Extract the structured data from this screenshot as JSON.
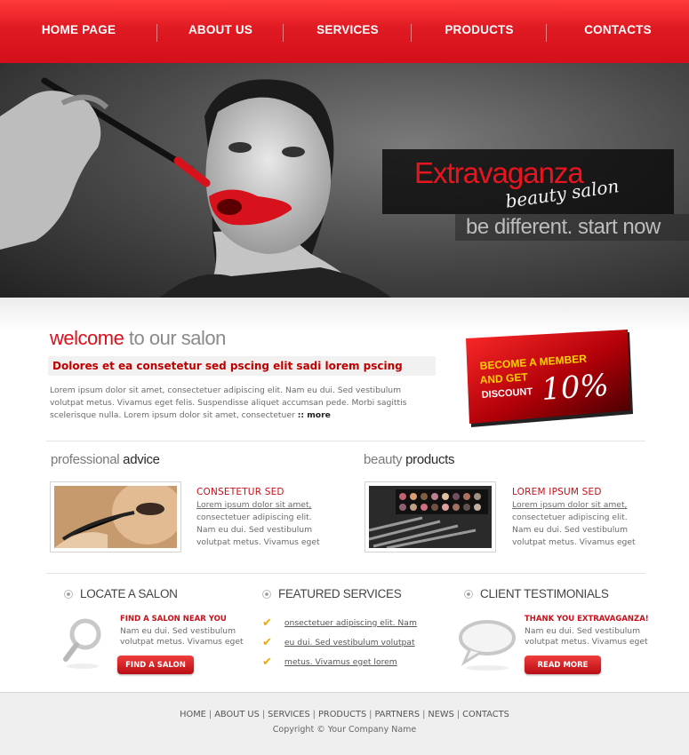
{
  "nav": {
    "items": [
      {
        "label": "HOME PAGE"
      },
      {
        "label": "ABOUT US"
      },
      {
        "label": "SERVICES"
      },
      {
        "label": "PRODUCTS"
      },
      {
        "label": "CONTACTS"
      }
    ]
  },
  "hero": {
    "brand": "Extravaganza",
    "brand_sub": "beauty salon",
    "slogan": "be different. start now"
  },
  "welcome": {
    "title_accent": "welcome",
    "title_rest": " to our salon",
    "subtitle": "Dolores et ea consetetur sed pscing elit sadi lorem pscing",
    "text": "Lorem ipsum dolor sit amet, consectetuer adipiscing elit. Nam eu dui. Sed vestibulum volutpat metus. Vivamus eget felis. Suspendisse aliquet accumsan pede. Morbi sagittis scelerisque nulla. Lorem ipsum dolor sit amet, consectetuer ",
    "more": ":: more"
  },
  "promo": {
    "line1": "BECOME A MEMBER",
    "line2": "AND GET",
    "line3": "DISCOUNT",
    "percent": "10%"
  },
  "advice": {
    "title_light": "professional ",
    "title_bold": "advice",
    "heading": "CONSETETUR SED",
    "link1": "Lorem ipsum dolor sit amet,",
    "text": "consectetuer adipiscing elit. Nam eu dui. Sed vestibulum volutpat metus. Vivamus eget"
  },
  "products": {
    "title_light": "beauty ",
    "title_bold": "products",
    "heading": "LOREM IPSUM SED",
    "link1": "Lorem ipsum dolor sit amet,",
    "text": "consectetuer adipiscing elit. Nam eu dui. Sed vestibulum volutpat metus. Vivamus eget"
  },
  "locate": {
    "title": "LOCATE A SALON",
    "heading": "FIND A SALON NEAR YOU",
    "text": "Nam eu dui. Sed vestibulum volutpat metus. Vivamus eget",
    "button": "FIND A SALON"
  },
  "featured": {
    "title": "FEATURED SERVICES",
    "items": [
      {
        "label": "onsectetuer adipiscing elit. Nam"
      },
      {
        "label": "eu dui. Sed vestibulum volutpat"
      },
      {
        "label": "metus. Vivamus eget lorem"
      }
    ]
  },
  "testimonials": {
    "title": "CLIENT TESTIMONIALS",
    "heading": "THANK YOU EXTRAVAGANZA!",
    "text": "Nam eu dui. Sed vestibulum volutpat metus. Vivamus eget",
    "button": "READ MORE"
  },
  "footer": {
    "links": [
      {
        "label": "HOME"
      },
      {
        "label": "ABOUT US"
      },
      {
        "label": "SERVICES"
      },
      {
        "label": "PRODUCTS"
      },
      {
        "label": "PARTNERS"
      },
      {
        "label": "NEWS"
      },
      {
        "label": "CONTACTS"
      }
    ],
    "copyright": "Copyright © Your Company Name"
  },
  "colors": {
    "brand_red": "#d8121c",
    "nav_red": "#e01a22"
  }
}
